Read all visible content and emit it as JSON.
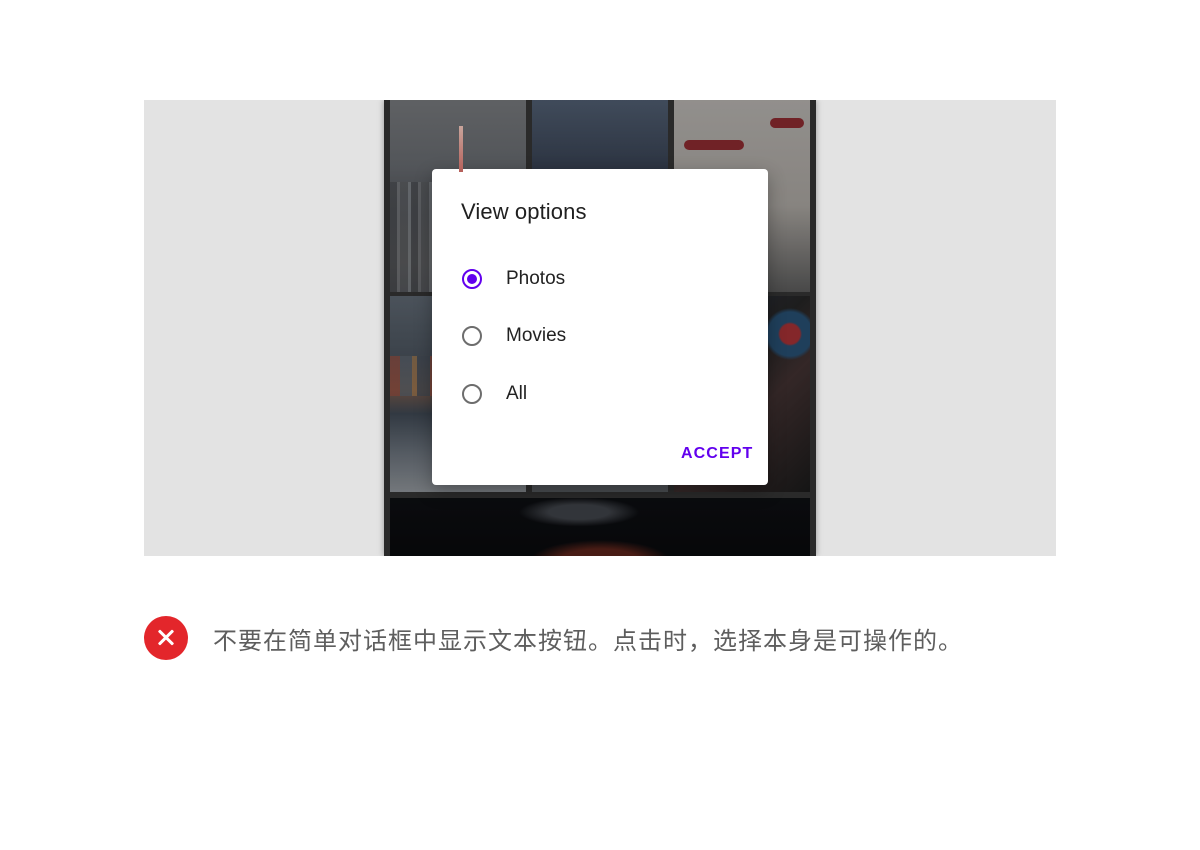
{
  "dialog": {
    "title": "View options",
    "options": [
      {
        "label": "Photos",
        "selected": true
      },
      {
        "label": "Movies",
        "selected": false
      },
      {
        "label": "All",
        "selected": false
      }
    ],
    "accept_label": "ACCEPT"
  },
  "caption": {
    "icon": "close-icon",
    "text": "不要在简单对话框中显示文本按钮。点击时，选择本身是可操作的。"
  },
  "colors": {
    "accent": "#6200ee",
    "error": "#e3262b",
    "stage_background": "#e3e3e3"
  }
}
